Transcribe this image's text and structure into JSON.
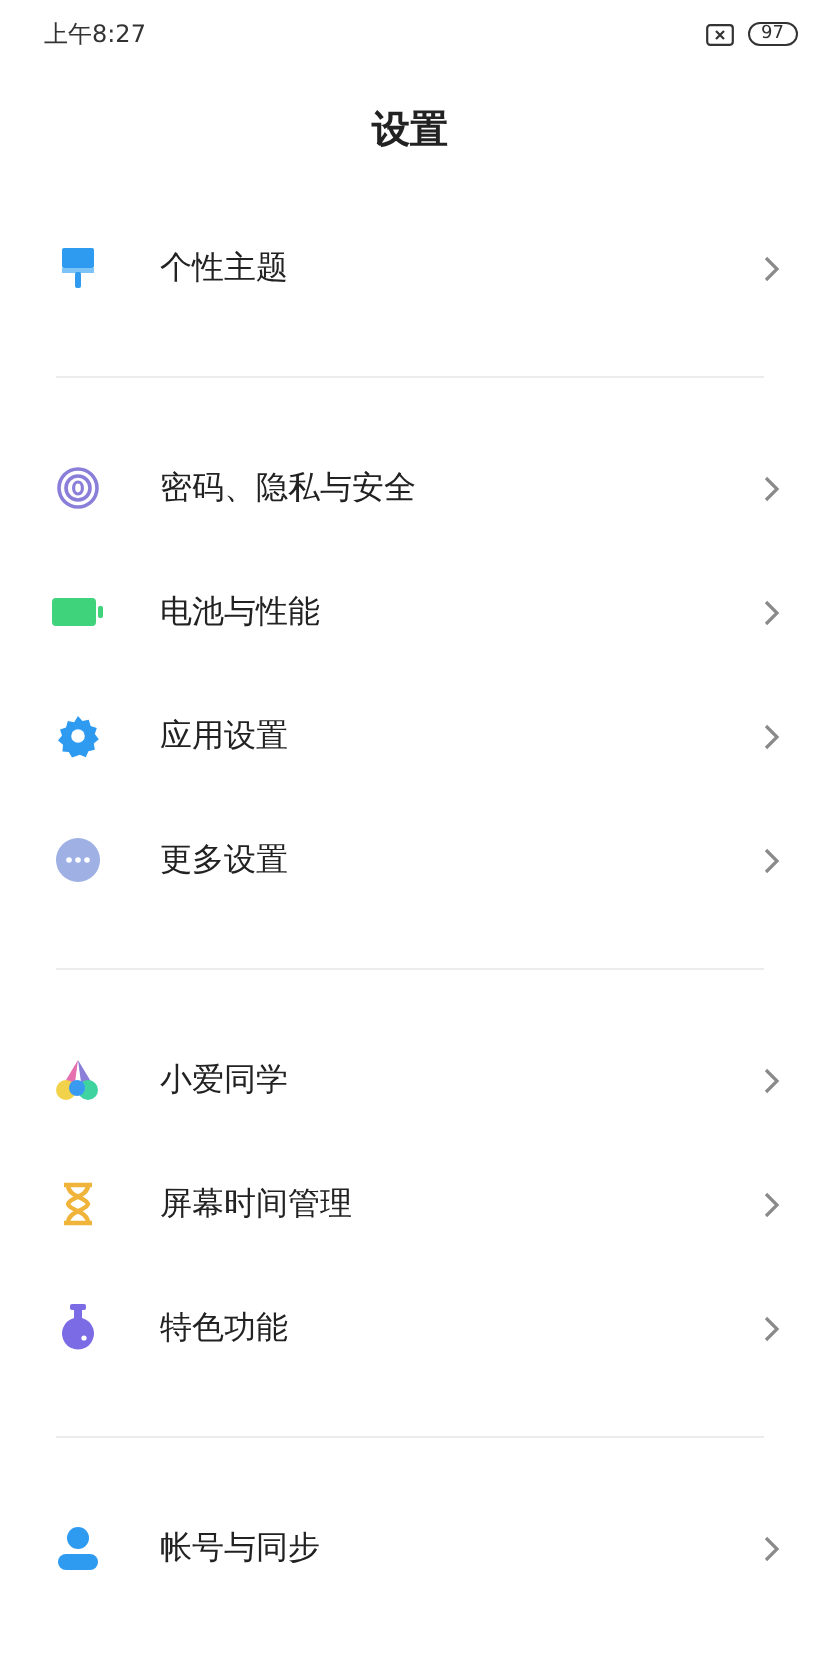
{
  "status_bar": {
    "time": "上午8:27",
    "battery": "97"
  },
  "title": "设置",
  "groups": [
    {
      "items": [
        {
          "label": "个性主题",
          "kind": "brush"
        }
      ]
    },
    {
      "items": [
        {
          "label": "密码、隐私与安全",
          "kind": "fingerprint"
        },
        {
          "label": "电池与性能",
          "kind": "battery"
        },
        {
          "label": "应用设置",
          "kind": "gear"
        },
        {
          "label": "更多设置",
          "kind": "more"
        }
      ]
    },
    {
      "items": [
        {
          "label": "小爱同学",
          "kind": "assistant"
        },
        {
          "label": "屏幕时间管理",
          "kind": "hourglass"
        },
        {
          "label": "特色功能",
          "kind": "flask"
        }
      ]
    },
    {
      "items": [
        {
          "label": "帐号与同步",
          "kind": "person"
        }
      ]
    }
  ]
}
